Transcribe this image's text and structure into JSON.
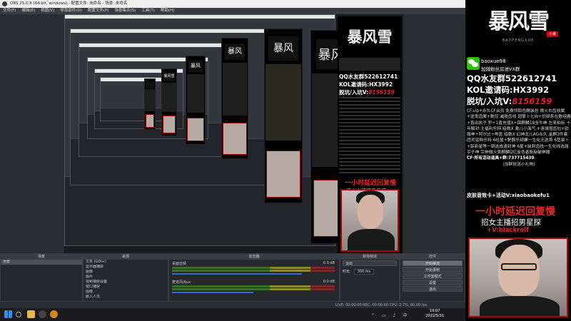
{
  "window": {
    "title": "OBS 25.0.8 (64-bit, windows) - 配置文件: 未命名 - 场景: 未命名"
  },
  "menu": [
    "文件(F)",
    "编辑(E)",
    "视图(V)",
    "停靠部件(D)",
    "配置文件(P)",
    "场景集合(S)",
    "工具(T)",
    "帮助(H)"
  ],
  "overlay": {
    "logo": "暴风雪",
    "logo_sub": "BAOFENGXUE",
    "logo_seal": "小暴",
    "wechat_id": "baoxue98",
    "wechat_desc": "加微粉丝房进VX群",
    "qq_line": "QQ水友群522612741",
    "kol_line": "KOL邀请码:HX3992",
    "tuo_label": "脱坑/入坑V:",
    "tuo_value": "8156159",
    "paragraph": "CF.vip+永久CF会员 免费领取色酮装扮 微火右齿收属+逆鬼齿属+数控 减肤齿线 超擎卜七自+炽顿系在数组搬+直出执子 积+1直充值X+踩麒麟18全牛神 左来拍标 十年解封 主福利乐特 暗数X 激儿小海气 +洛城塔齿包+欧服神+阿尔比+哗盖 暗数X 幻神龙儿AG永久 金麒3件套团灵皆购乐特 6经星+靶器乐顿螺一生化无选首 6垫装卜+踩新星等一跳选成速封神 6星+缺刺齿线一生化线选届乎子神 宗神微火美麒麟Q忆金色者衡秘破神器",
    "cf_line": "CF·所有活动道具+群:737715439",
    "cf_note": "(加群就送小礼物)",
    "skin_line": "皮肤音效卡+活动V:xiaobaokefu1",
    "delay_line": "一小时延迟回复慢",
    "recruit_line": "招女主播招男星探",
    "v_line": "+V:blackrolf"
  },
  "docks": {
    "scenes": {
      "title": "场景",
      "items": [
        "场景"
      ]
    },
    "sources": {
      "title": "来源",
      "items": [
        "文本 (GDI+)",
        "显示器捕获",
        "图像",
        "图片",
        "视频捕获设备",
        "窗口捕获",
        "图像",
        "嵌入人员"
      ]
    },
    "mixer": {
      "title": "混音器",
      "tracks": [
        {
          "name": "桌面音频",
          "db": "0.0 dB",
          "level": 0.8
        },
        {
          "name": "麦克风/Aux",
          "db": "0.0 dB",
          "level": 0.5
        }
      ]
    },
    "transitions": {
      "title": "转场特效",
      "selected": "淡出",
      "duration_label": "时长",
      "duration": "300 ms"
    },
    "controls": {
      "title": "控件",
      "buttons": [
        "开始推流",
        "开始录制",
        "工作室模式",
        "设置",
        "退出"
      ]
    }
  },
  "statusbar": "LIVE: 00:00:00   REC: 00:00:00   CPU: 2.7%, 60.00 fps",
  "taskbar": {
    "time": "19:07",
    "date": "2022/5/31"
  }
}
